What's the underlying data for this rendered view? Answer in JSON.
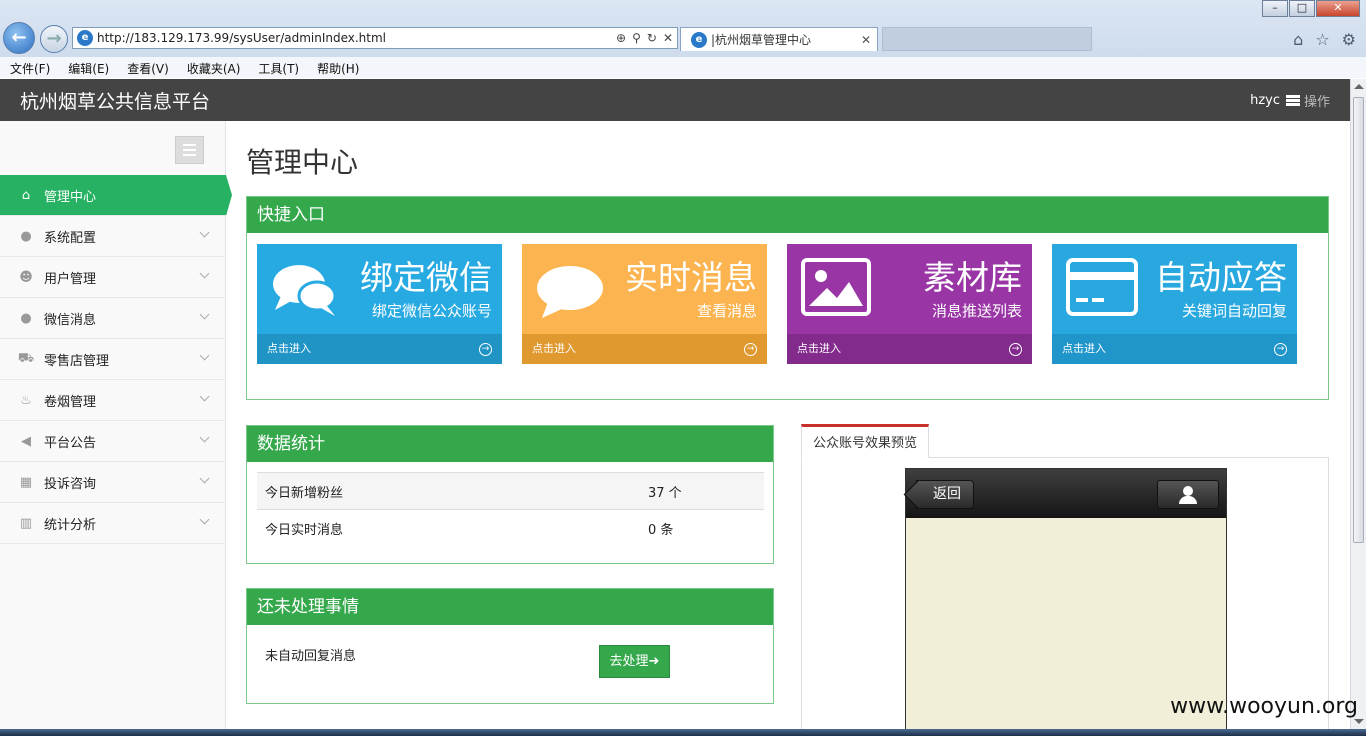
{
  "browser": {
    "url": "http://183.129.173.99/sysUser/adminIndex.html",
    "tab_title": "|杭州烟草管理中心",
    "menu": [
      "文件(F)",
      "编辑(E)",
      "查看(V)",
      "收藏夹(A)",
      "工具(T)",
      "帮助(H)"
    ]
  },
  "header": {
    "brand": "杭州烟草公共信息平台",
    "user": "hzyc",
    "ops": "操作"
  },
  "sidebar": {
    "items": [
      {
        "label": "管理中心",
        "icon": "home-icon"
      },
      {
        "label": "系统配置",
        "icon": "comment-icon"
      },
      {
        "label": "用户管理",
        "icon": "users-icon"
      },
      {
        "label": "微信消息",
        "icon": "comment-icon"
      },
      {
        "label": "零售店管理",
        "icon": "cart-icon"
      },
      {
        "label": "卷烟管理",
        "icon": "flame-icon"
      },
      {
        "label": "平台公告",
        "icon": "megaphone-icon"
      },
      {
        "label": "投诉咨询",
        "icon": "qrcode-icon"
      },
      {
        "label": "统计分析",
        "icon": "bar-chart-icon"
      }
    ]
  },
  "main": {
    "title": "管理中心",
    "quick": {
      "heading": "快捷入口",
      "tiles": [
        {
          "title": "绑定微信",
          "sub": "绑定微信公众账号",
          "link": "点击进入",
          "color": "#27a9e1"
        },
        {
          "title": "实时消息",
          "sub": "查看消息",
          "link": "点击进入",
          "color": "#fbb450"
        },
        {
          "title": "素材库",
          "sub": "消息推送列表",
          "link": "点击进入",
          "color": "#9a35a6"
        },
        {
          "title": "自动应答",
          "sub": "关键词自动回复",
          "link": "点击进入",
          "color": "#29a8e0"
        }
      ]
    },
    "stats": {
      "heading": "数据统计",
      "rows": [
        {
          "label": "今日新增粉丝",
          "value": "37 个"
        },
        {
          "label": "今日实时消息",
          "value": "0 条"
        }
      ]
    },
    "pending": {
      "heading": "还未处理事情",
      "label": "未自动回复消息",
      "button": "去处理"
    },
    "preview": {
      "tab": "公众账号效果预览",
      "back": "返回"
    }
  },
  "watermark": "www.wooyun.org"
}
